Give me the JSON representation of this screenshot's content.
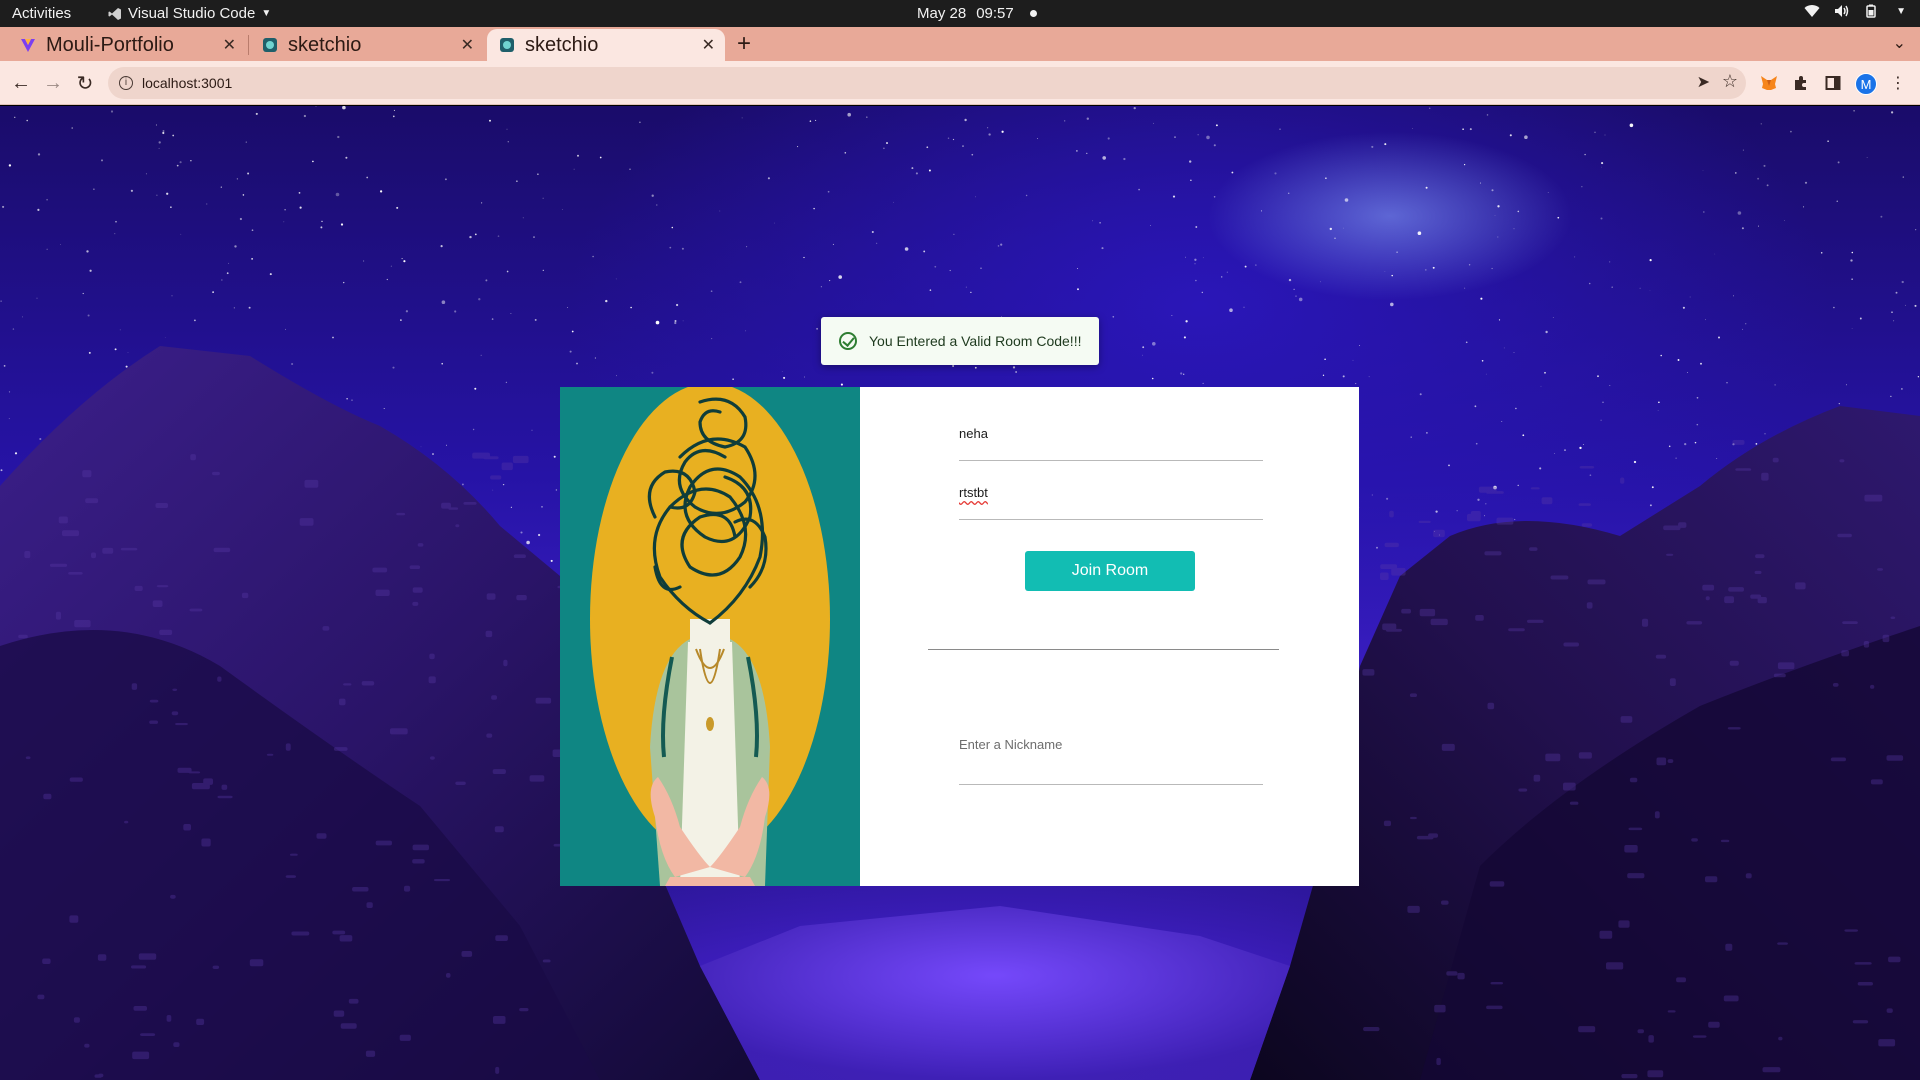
{
  "topbar": {
    "activities": "Activities",
    "app_name": "Visual Studio Code",
    "date": "May 28",
    "time": "09:57"
  },
  "browser": {
    "tabs": [
      {
        "title": "Mouli-Portfolio",
        "favicon": "vercel-v-icon",
        "active": false
      },
      {
        "title": "sketchio",
        "favicon": "sketchio-icon",
        "active": false
      },
      {
        "title": "sketchio",
        "favicon": "sketchio-icon",
        "active": true
      }
    ],
    "url": "localhost:3001",
    "profile_initial": "M",
    "colors": {
      "tabstrip": "#e8a998",
      "toolbar": "#fbe7e1"
    }
  },
  "toast": {
    "message": "You Entered a Valid Room Code!!!",
    "icon": "check-circle-icon",
    "accent": "#2e7d32"
  },
  "form": {
    "name_value": "neha",
    "room_code_value": "rtstbt",
    "join_label": "Join Room",
    "nickname_placeholder": "Enter a Nickname",
    "accent": "#12bdb3"
  }
}
